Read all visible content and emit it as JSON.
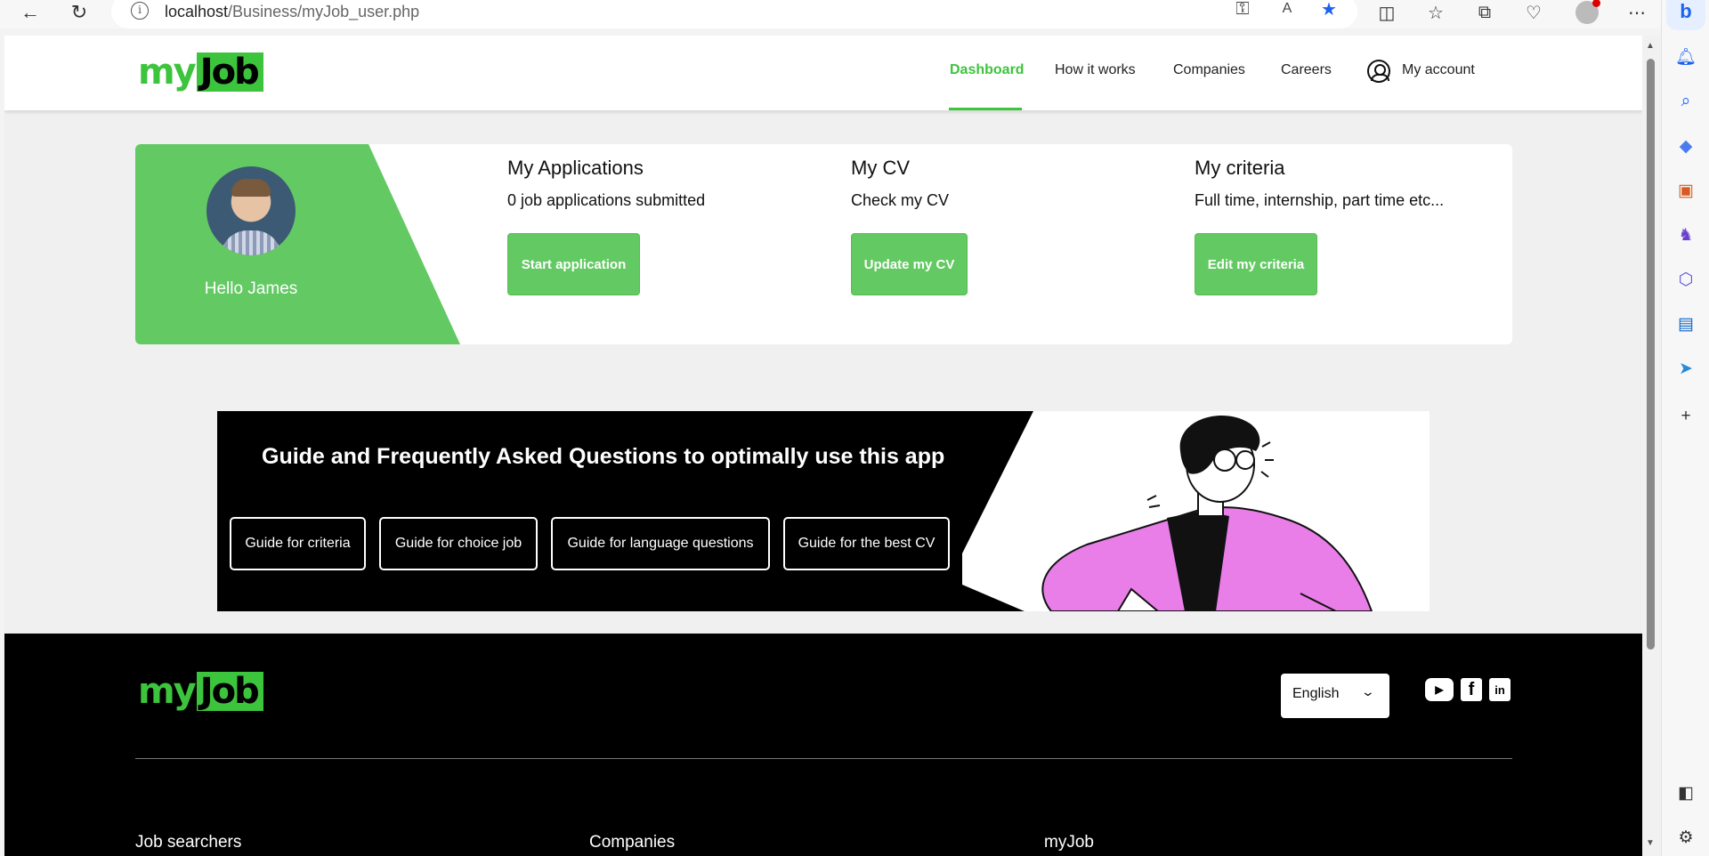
{
  "browser": {
    "url_host": "localhost",
    "url_path": "/Business/myJob_user.php"
  },
  "header": {
    "logo_my": "my",
    "logo_job": "Job",
    "nav": [
      "Dashboard",
      "How it works",
      "Companies",
      "Careers"
    ],
    "account_label": "My account"
  },
  "profile": {
    "greeting": "Hello James",
    "columns": [
      {
        "title": "My Applications",
        "subtitle": "0 job applications submitted",
        "button": "Start application"
      },
      {
        "title": "My CV",
        "subtitle": "Check my CV",
        "button": "Update my CV"
      },
      {
        "title": "My criteria",
        "subtitle": "Full time, internship, part time etc...",
        "button": "Edit my criteria"
      }
    ]
  },
  "faq": {
    "title": "Guide and Frequently Asked Questions to optimally use this app",
    "buttons": [
      "Guide for criteria",
      "Guide for choice job",
      "Guide for language questions",
      "Guide for the best CV"
    ]
  },
  "footer": {
    "logo_my": "my",
    "logo_job": "Job",
    "language": "English",
    "social": {
      "youtube": "▶",
      "facebook": "f",
      "linkedin": "in"
    },
    "columns": [
      "Job searchers",
      "Companies",
      "myJob"
    ]
  },
  "colors": {
    "accent": "#3dc43d",
    "card_green": "#63c963",
    "banner_bg": "#000000",
    "illustration_shirt": "#e97ee9"
  },
  "icons": {
    "back": "arrow-left-icon",
    "refresh": "refresh-icon",
    "info": "info-icon",
    "favorites": "star-icon",
    "account": "user-circle-icon"
  }
}
